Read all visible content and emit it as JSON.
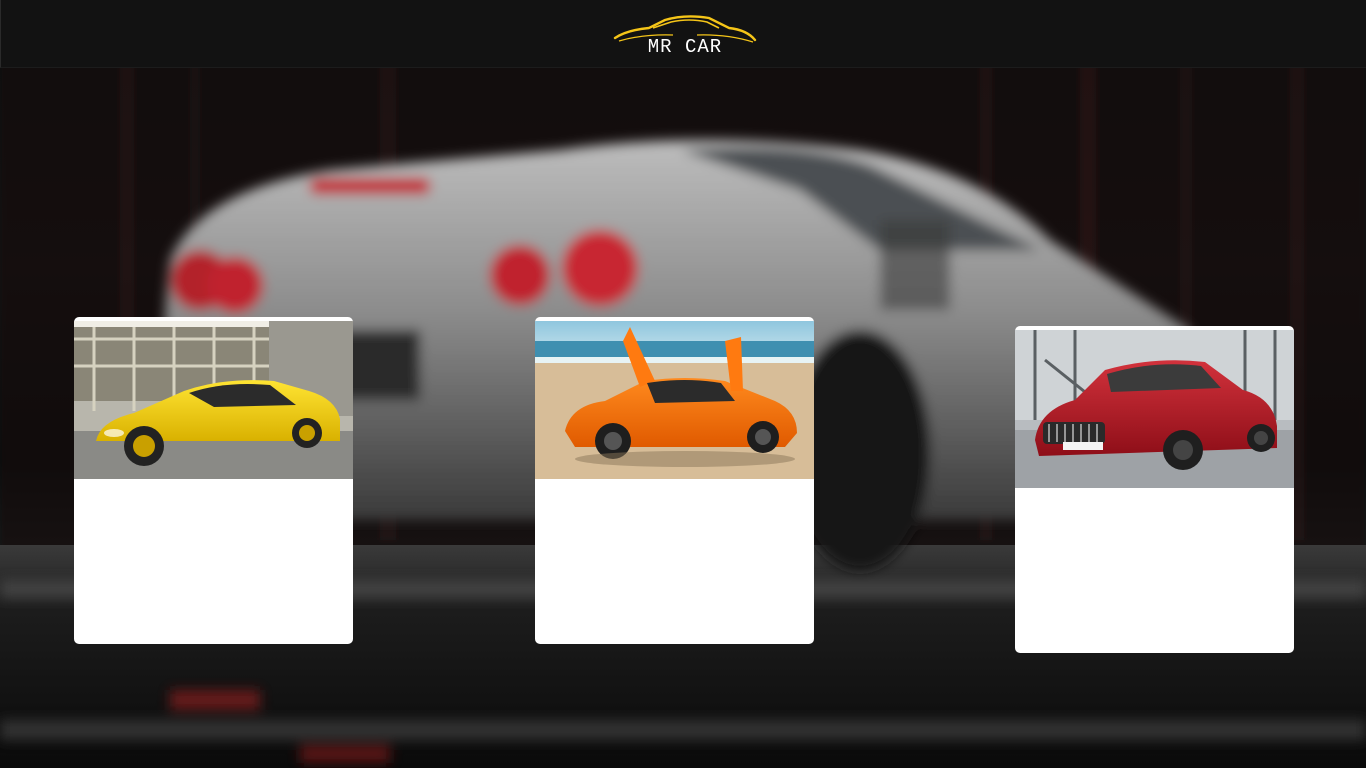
{
  "header": {
    "brand": "MR CAR"
  },
  "icons": {
    "logo": "car-silhouette-icon"
  },
  "colors": {
    "header_bg": "#121212",
    "logo_accent": "#f5c518",
    "card_bg": "#ffffff"
  },
  "cards": [
    {
      "photo": "yellow-sports-car-photo"
    },
    {
      "photo": "orange-sports-car-photo"
    },
    {
      "photo": "red-sedan-photo"
    }
  ]
}
